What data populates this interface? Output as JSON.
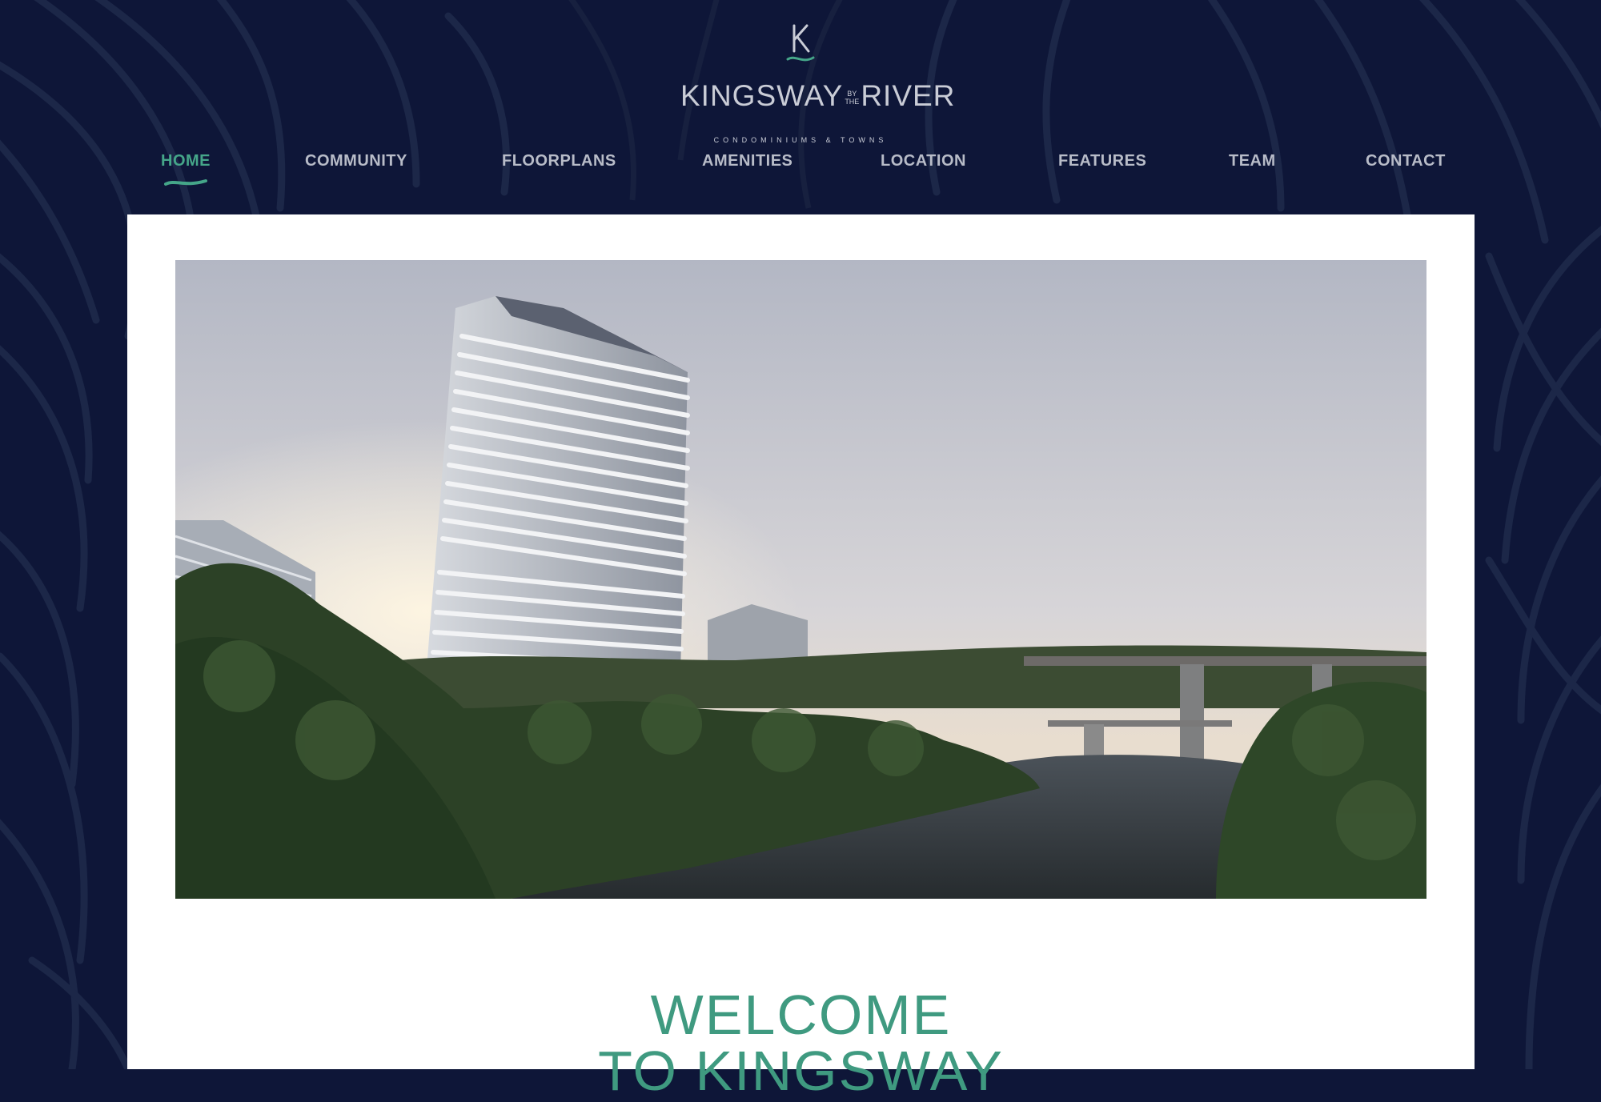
{
  "brand": {
    "logo_letter": "K",
    "name_left": "KINGSWAY",
    "name_by": "BY",
    "name_the": "THE",
    "name_right": "RIVER",
    "tagline": "CONDOMINIUMS & TOWNS"
  },
  "nav": {
    "items": [
      {
        "label": "HOME",
        "active": true
      },
      {
        "label": "COMMUNITY",
        "active": false
      },
      {
        "label": "FLOORPLANS",
        "active": false
      },
      {
        "label": "AMENITIES",
        "active": false
      },
      {
        "label": "LOCATION",
        "active": false
      },
      {
        "label": "FEATURES",
        "active": false
      },
      {
        "label": "TEAM",
        "active": false
      },
      {
        "label": "CONTACT",
        "active": false
      }
    ]
  },
  "hero": {
    "image_icon": "rendering-tower-by-river"
  },
  "welcome": {
    "line1": "WELCOME",
    "line2": "TO KINGSWAY"
  },
  "colors": {
    "background": "#0e1638",
    "accent": "#45a689",
    "nav_text": "#b8bcc8",
    "card": "#ffffff"
  }
}
